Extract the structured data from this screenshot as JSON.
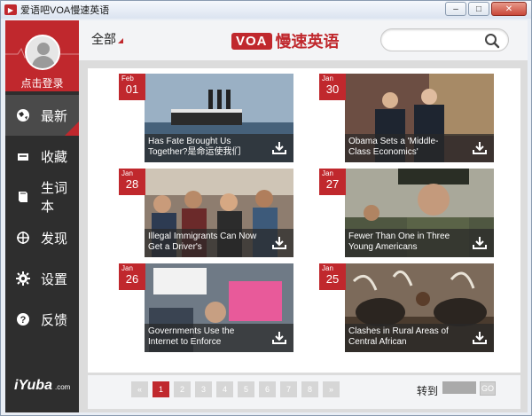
{
  "window": {
    "title": "爱语吧VOA慢速英语",
    "minimize": "–",
    "maximize": "□",
    "close": "✕"
  },
  "sidebar": {
    "login_label": "点击登录",
    "items": [
      {
        "label": "最新",
        "icon": "globe-icon"
      },
      {
        "label": "收藏",
        "icon": "inbox-icon"
      },
      {
        "label": "生词本",
        "icon": "book-icon"
      },
      {
        "label": "发现",
        "icon": "crosshair-icon"
      },
      {
        "label": "设置",
        "icon": "gear-icon"
      },
      {
        "label": "反馈",
        "icon": "question-icon"
      }
    ],
    "logo": "iYuba",
    "logo_sub": ".com"
  },
  "header": {
    "filter_label": "全部",
    "brand_mark": "VOA",
    "brand_text": "慢速英语",
    "search_placeholder": ""
  },
  "articles": [
    {
      "month": "Feb",
      "day": "01",
      "title": "Has Fate Brought Us Together?是命运使我们"
    },
    {
      "month": "Jan",
      "day": "30",
      "title": "Obama Sets a 'Middle-Class Economics'"
    },
    {
      "month": "Jan",
      "day": "28",
      "title": "Illegal Immigrants Can Now Get a Driver's"
    },
    {
      "month": "Jan",
      "day": "27",
      "title": "Fewer Than One in Three Young Americans"
    },
    {
      "month": "Jan",
      "day": "26",
      "title": "Governments Use the Internet to Enforce"
    },
    {
      "month": "Jan",
      "day": "25",
      "title": "Clashes in Rural Areas of Central African"
    }
  ],
  "pager": {
    "prev": "«",
    "pages": [
      "1",
      "2",
      "3",
      "4",
      "5",
      "6",
      "7",
      "8"
    ],
    "current_page": 1,
    "next": "»",
    "goto_label": "转到",
    "goto_button": "GO"
  },
  "colors": {
    "accent": "#c0282d",
    "sidebar_bg": "#2e2e2e"
  }
}
